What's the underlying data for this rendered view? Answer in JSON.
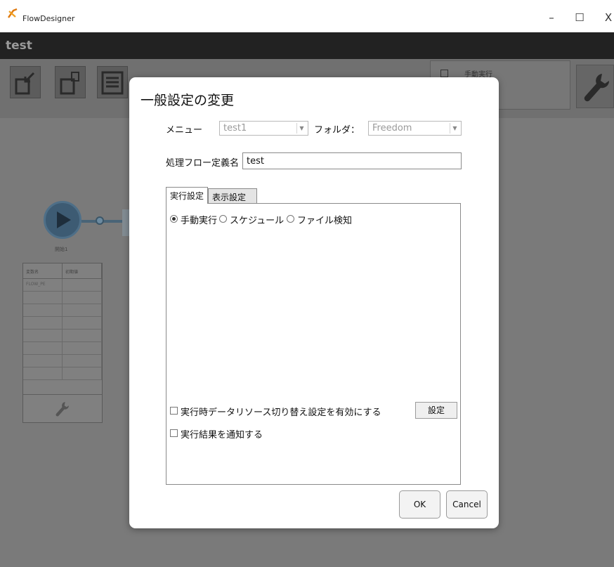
{
  "window": {
    "title": "FlowDesigner",
    "controls": {
      "minimize": "–",
      "maximize": "☐",
      "close": "X"
    }
  },
  "project": {
    "name": "test"
  },
  "toolbar": {
    "run_mode_label": "手動実行"
  },
  "canvas": {
    "start_node_label": "開始1",
    "variables_table": {
      "columns": [
        "変数名",
        "初期値"
      ],
      "rows": [
        [
          "FLOW_PE",
          ""
        ]
      ]
    }
  },
  "dialog": {
    "title": "一般設定の変更",
    "menu_label": "メニュー",
    "menu_value": "test1",
    "folder_label": "フォルダ：",
    "folder_value": "Freedom",
    "flow_name_label": "処理フロー定義名",
    "flow_name_value": "test",
    "tabs": [
      "実行設定",
      "表示設定"
    ],
    "execution": {
      "options": [
        "手動実行",
        "スケジュール",
        "ファイル検知"
      ],
      "selected": "手動実行"
    },
    "datasource_switch_label": "実行時データリソース切り替え設定を有効にする",
    "datasource_settings_button": "設定",
    "notify_label": "実行結果を通知する",
    "ok_label": "OK",
    "cancel_label": "Cancel"
  },
  "colors": {
    "titlebar_dark": "#222222",
    "overlay": "#7a7a7a",
    "dialog_bg": "#ffffff",
    "start_node": "#3d5b73"
  }
}
